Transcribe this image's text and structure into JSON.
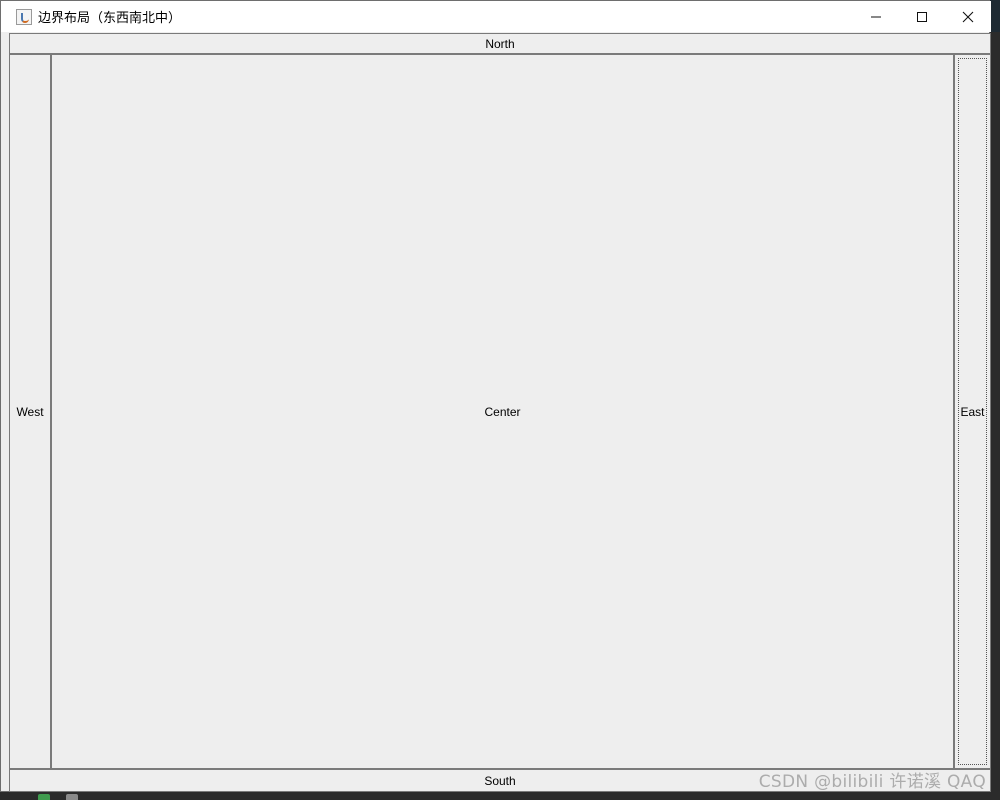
{
  "window": {
    "title": "边界布局（东西南北中）"
  },
  "regions": {
    "north": "North",
    "west": "West",
    "center": "Center",
    "east": "East",
    "south": "South"
  },
  "watermark": "CSDN @bilibili   许诺溪  QAQ",
  "icons": {
    "app": "java-cup-icon",
    "minimize": "minimize-icon",
    "maximize": "maximize-icon",
    "close": "close-icon"
  },
  "colors": {
    "panel_background": "#eeeeee",
    "titlebar_background": "#ffffff",
    "button_border": "#7a7a7a"
  }
}
